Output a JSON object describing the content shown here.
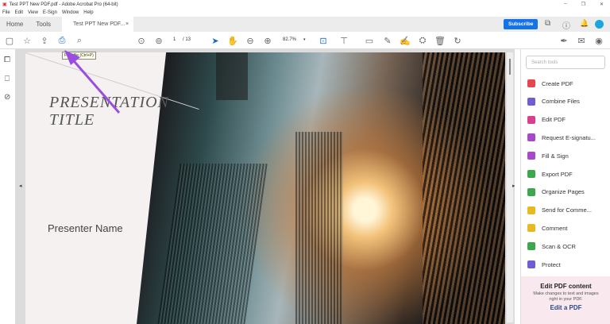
{
  "window": {
    "title": "Test PPT New PDF.pdf - Adobe Acrobat Pro (64-bit)",
    "controls": [
      "–",
      "❐",
      "✕"
    ]
  },
  "menu": [
    "File",
    "Edit",
    "View",
    "E-Sign",
    "Window",
    "Help"
  ],
  "tabs": {
    "home": "Home",
    "tools": "Tools",
    "document": "Test PPT New PDF...",
    "close": "×"
  },
  "header": {
    "subscribe": "Subscribe"
  },
  "toolbar": {
    "page_current": "1",
    "page_total": "/ 13",
    "zoom": "82.7%",
    "tooltip": "Print file (Ctrl+P)"
  },
  "document": {
    "title_line1": "PRESENTATION",
    "title_line2": "TITLE",
    "presenter": "Presenter Name"
  },
  "right_panel": {
    "search_placeholder": "Search tools",
    "tools": [
      {
        "label": "Create PDF",
        "color": "#e34850"
      },
      {
        "label": "Combine Files",
        "color": "#6d5fd3"
      },
      {
        "label": "Edit PDF",
        "color": "#d93f8f"
      },
      {
        "label": "Request E-signatu...",
        "color": "#a54bc9"
      },
      {
        "label": "Fill & Sign",
        "color": "#a54bc9"
      },
      {
        "label": "Export PDF",
        "color": "#3da74e"
      },
      {
        "label": "Organize Pages",
        "color": "#3da74e"
      },
      {
        "label": "Send for Comme...",
        "color": "#e8b923"
      },
      {
        "label": "Comment",
        "color": "#e8b923"
      },
      {
        "label": "Scan & OCR",
        "color": "#3da74e"
      },
      {
        "label": "Protect",
        "color": "#6d5fd3"
      }
    ],
    "promo": {
      "title": "Edit PDF content",
      "text": "Make changes to text and images right in your PDF.",
      "link": "Edit a PDF"
    }
  },
  "colors": {
    "accent": "#1473e6",
    "annotation_arrow": "#9b4de0"
  }
}
